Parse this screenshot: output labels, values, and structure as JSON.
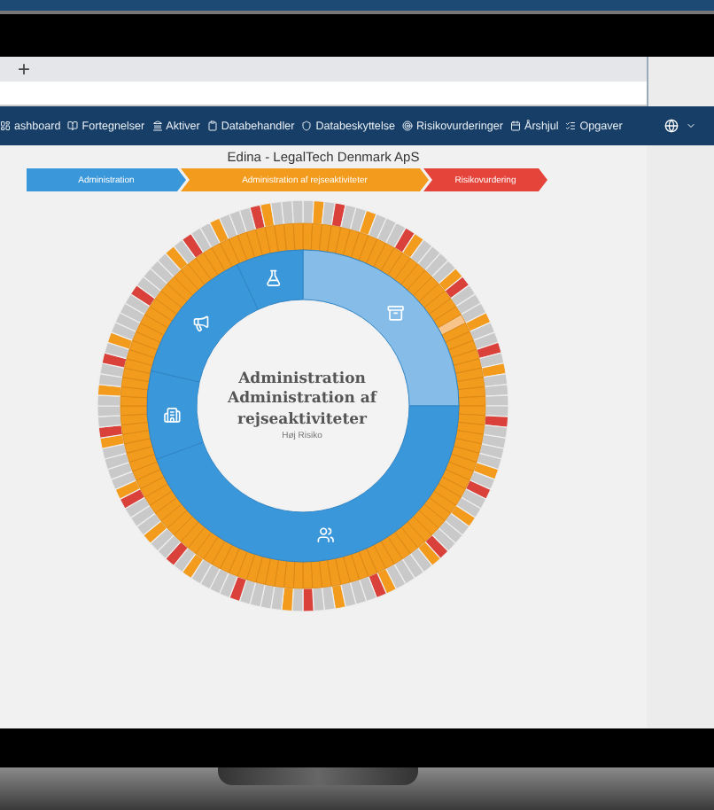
{
  "browser": {
    "new_tab": "+"
  },
  "nav": {
    "items": [
      {
        "label": "ashboard"
      },
      {
        "label": "Fortegnelser"
      },
      {
        "label": "Aktiver"
      },
      {
        "label": "Databehandler"
      },
      {
        "label": "Databeskyttelse"
      },
      {
        "label": "Risikovurderinger"
      },
      {
        "label": "Årshjul"
      },
      {
        "label": "Opgaver"
      }
    ]
  },
  "page_title": "Edina - LegalTech Denmark ApS",
  "steps": [
    {
      "label": "Administration",
      "color": "#3a97d9"
    },
    {
      "label": "Administration af rejseaktiviteter",
      "color": "#f39b1c"
    },
    {
      "label": "Risikovurdering",
      "color": "#e5443a"
    }
  ],
  "wheel_center": {
    "title": "Administration",
    "subtitle": "Administration af rejseaktiviteter",
    "caption": "Høj Risiko"
  }
}
